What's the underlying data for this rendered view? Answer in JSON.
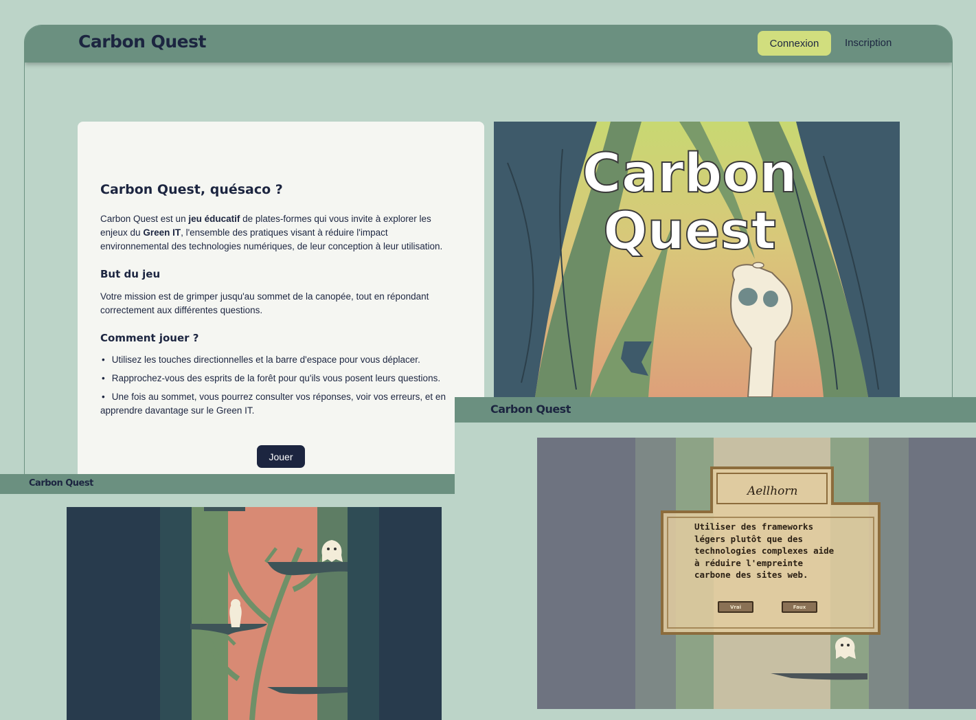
{
  "app": {
    "logo": "Carbon Quest"
  },
  "nav": {
    "login_label": "Connexion",
    "signup_label": "Inscription"
  },
  "card": {
    "title": "Carbon Quest, quésaco ?",
    "intro": {
      "before": "Carbon Quest est un ",
      "bold1": "jeu éducatif",
      "middle": " de plates-formes qui vous invite à explorer les enjeux du ",
      "bold2": "Green IT",
      "after": ", l'ensemble des pratiques visant à réduire l'impact environnemental des technologies numériques, de leur conception à leur utilisation."
    },
    "goal_title": "But du jeu",
    "goal_text": "Votre mission est de grimper jusqu'au sommet de la canopée, tout en répondant correctement aux différentes questions.",
    "howto_title": "Comment jouer ?",
    "howto_items": [
      "Utilisez les touches directionnelles et la barre d'espace pour vous déplacer.",
      "Rapprochez-vous des esprits de la forêt pour qu'ils vous posent leurs questions.",
      "Une fois au sommet, vous pourrez consulter vos réponses, voir vos erreurs, et en apprendre davantage sur le Green IT."
    ],
    "play_label": "Jouer"
  },
  "key_art": {
    "title_line1": "Carbon",
    "title_line2": "Quest"
  },
  "dialog": {
    "speaker": "Aellhorn",
    "question": "Utiliser des frameworks légers plutôt que des technologies complexes aide à réduire l'empreinte carbone des sites web.",
    "true_label": "Vrai",
    "false_label": "Faux"
  },
  "colors": {
    "background": "#bcd4c8",
    "header": "#6b9080",
    "accent": "#d1de7e",
    "navy": "#1c2540",
    "card": "#f5f6f2"
  }
}
